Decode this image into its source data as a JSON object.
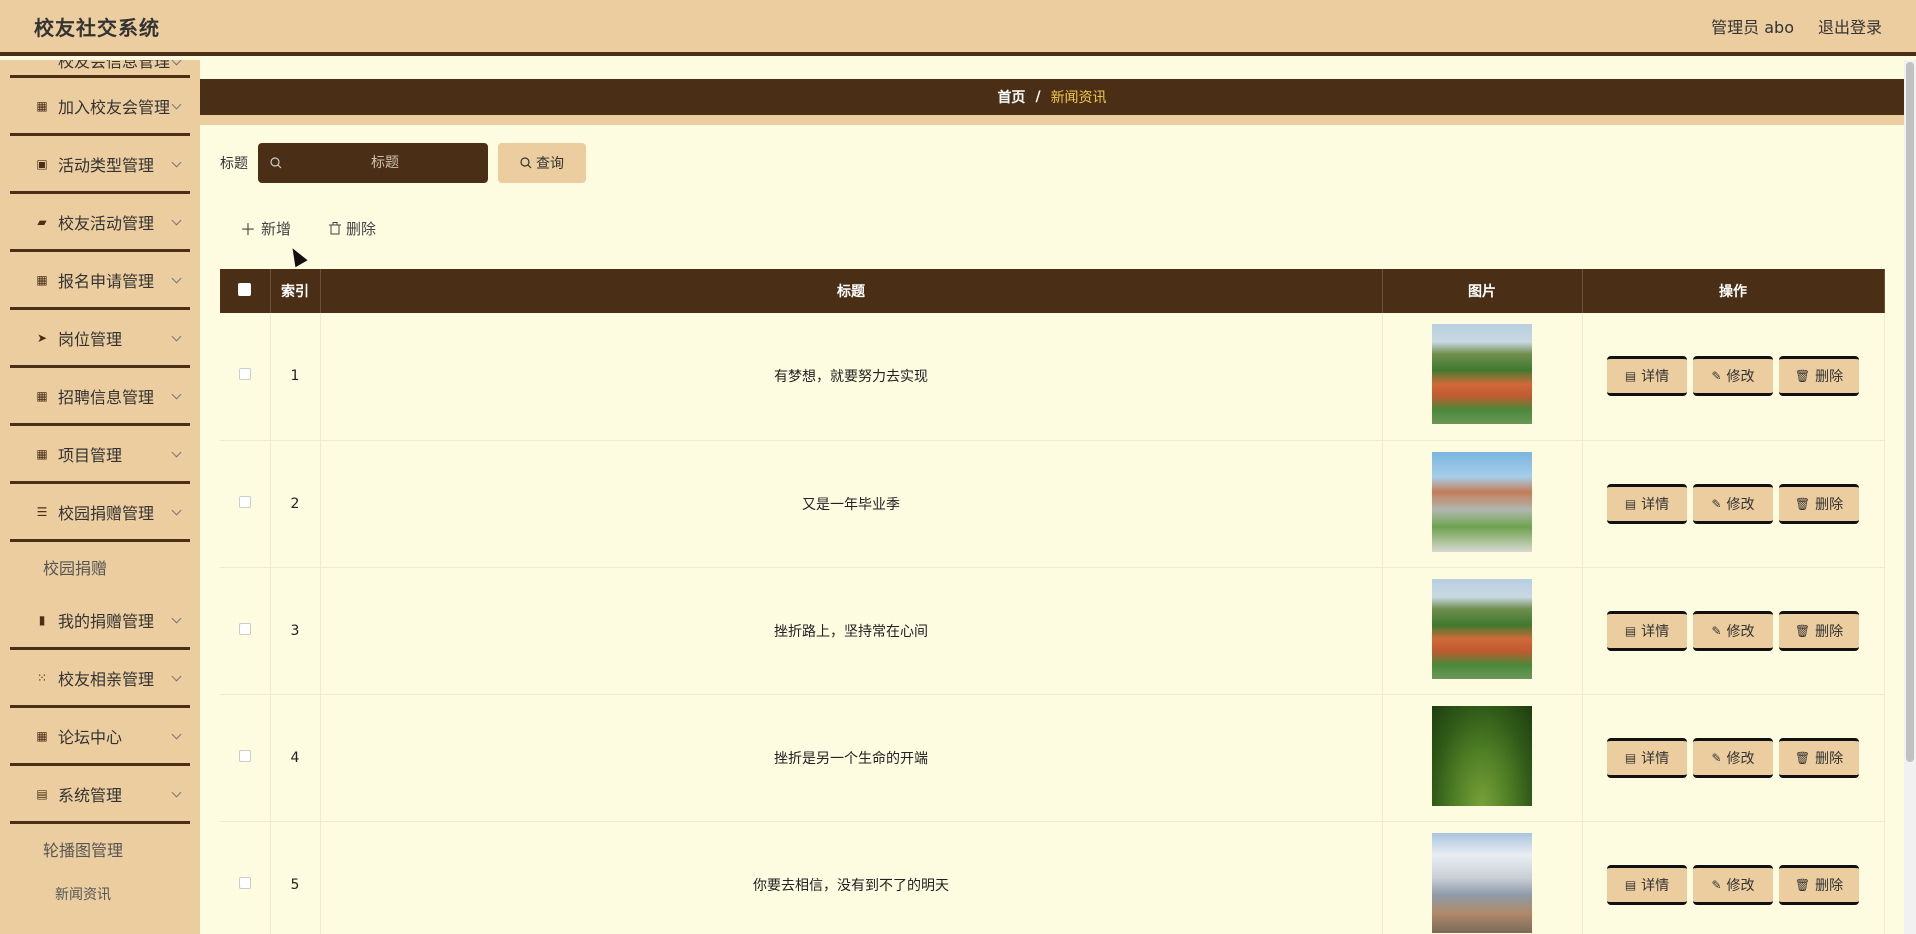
{
  "header": {
    "app_title": "校友社交系统",
    "user_label": "管理员 abo",
    "logout_label": "退出登录"
  },
  "sidebar": {
    "items": [
      {
        "label": "校友会信息管理",
        "icon": "grid-icon"
      },
      {
        "label": "加入校友会管理",
        "icon": "grid-icon"
      },
      {
        "label": "活动类型管理",
        "icon": "clipboard-icon"
      },
      {
        "label": "校友活动管理",
        "icon": "wallet-icon"
      },
      {
        "label": "报名申请管理",
        "icon": "grid-icon"
      },
      {
        "label": "岗位管理",
        "icon": "send-icon"
      },
      {
        "label": "招聘信息管理",
        "icon": "grid-icon"
      },
      {
        "label": "项目管理",
        "icon": "grid-icon"
      },
      {
        "label": "校园捐赠管理",
        "icon": "list-icon"
      },
      {
        "label": "校园捐赠",
        "sub": true
      },
      {
        "label": "我的捐赠管理",
        "icon": "bar-chart-icon"
      },
      {
        "label": "校友相亲管理",
        "icon": "apps-icon"
      },
      {
        "label": "论坛中心",
        "icon": "grid-icon"
      },
      {
        "label": "系统管理",
        "icon": "document-icon"
      },
      {
        "label": "轮播图管理",
        "sub": true
      },
      {
        "label": "新闻资讯",
        "sub": true
      }
    ]
  },
  "breadcrumb": {
    "home": "首页",
    "separator": "/",
    "current": "新闻资讯"
  },
  "search": {
    "label": "标题",
    "placeholder": "标题",
    "query_label": "查询"
  },
  "actions": {
    "add_label": "新增",
    "delete_label": "删除"
  },
  "table": {
    "columns": [
      "索引",
      "标题",
      "图片",
      "操作"
    ],
    "rows": [
      {
        "index": "1",
        "title": "有梦想，就要努力去实现",
        "image": "track"
      },
      {
        "index": "2",
        "title": "又是一年毕业季",
        "image": "building"
      },
      {
        "index": "3",
        "title": "挫折路上，坚持常在心间",
        "image": "track"
      },
      {
        "index": "4",
        "title": "挫折是另一个生命的开端",
        "image": "forest"
      },
      {
        "index": "5",
        "title": "你要去相信，没有到不了的明天",
        "image": "modern"
      }
    ],
    "row_actions": {
      "detail": "详情",
      "edit": "修改",
      "delete": "删除"
    }
  },
  "colors": {
    "primary_dark": "#4a2f16",
    "accent_tan": "#ebcd9f",
    "page_bg": "#fdfbe0",
    "breadcrumb_active": "#f0c94a"
  }
}
